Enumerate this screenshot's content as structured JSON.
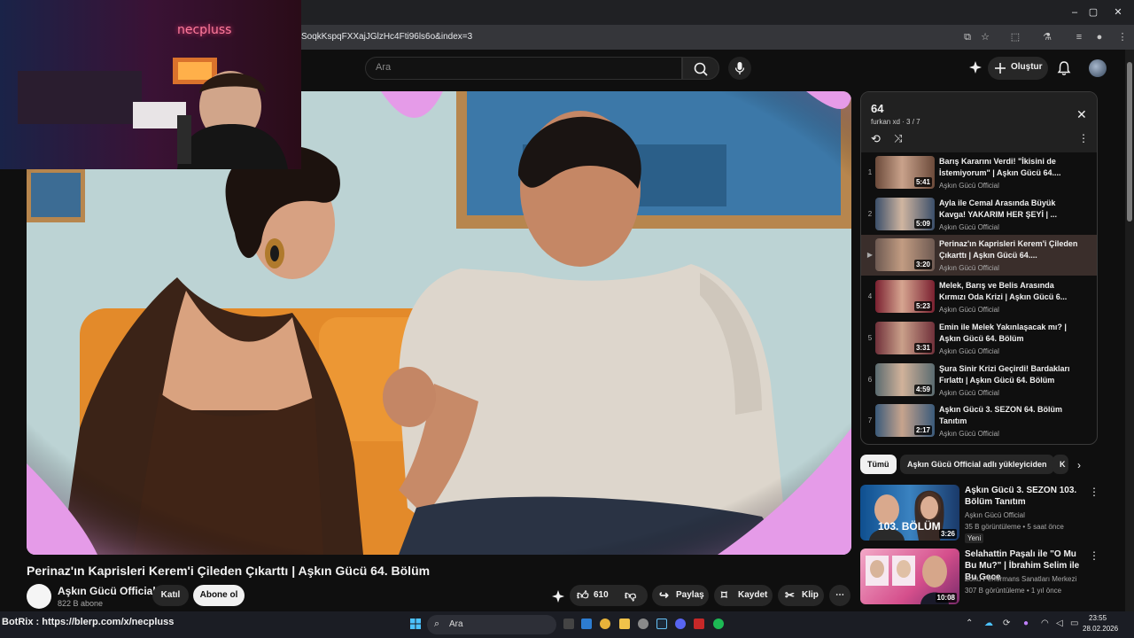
{
  "browser": {
    "url_fragment": "SoqkKspqFXXajJGlzHc4Fti96ls6o&index=3",
    "window_controls": [
      "–",
      "▢",
      "✕"
    ]
  },
  "header": {
    "search_placeholder": "Ara",
    "create_label": "Oluştur"
  },
  "stream_overlay": {
    "cam_logo": "necpluss",
    "botrix_text": "BotRix : https://blerp.com/x/necpluss"
  },
  "video": {
    "title": "Perinaz'ın Kaprisleri Kerem'i Çileden Çıkarttı | Aşkın Gücü 64. Bölüm",
    "channel_name": "Aşkın Gücü Official",
    "channel_subs": "822 B abone",
    "join_label": "Katıl",
    "subscribe_label": "Abone ol",
    "like_count": "610",
    "share_label": "Paylaş",
    "save_label": "Kaydet",
    "clip_label": "Klip"
  },
  "playlist": {
    "title": "64",
    "subtitle": "furkan xd · 3 / 7",
    "items": [
      {
        "index": "1",
        "title": "Barış Kararını Verdi! \"İkisini de İstemiyorum\" | Aşkın Gücü 64....",
        "channel": "Aşkın Gücü Official",
        "duration": "5:41",
        "active": false
      },
      {
        "index": "2",
        "title": "Ayla ile Cemal Arasında Büyük Kavga! YAKARIM HER ŞEYİ | ...",
        "channel": "Aşkın Gücü Official",
        "duration": "5:09",
        "active": false
      },
      {
        "index": "▶",
        "title": "Perinaz'ın Kaprisleri Kerem'i Çileden Çıkarttı | Aşkın Gücü 64....",
        "channel": "Aşkın Gücü Official",
        "duration": "3:20",
        "active": true
      },
      {
        "index": "4",
        "title": "Melek, Barış ve Belis Arasında Kırmızı Oda Krizi | Aşkın Gücü 6...",
        "channel": "Aşkın Gücü Official",
        "duration": "5:23",
        "active": false
      },
      {
        "index": "5",
        "title": "Emin ile Melek Yakınlaşacak mı? | Aşkın Gücü 64. Bölüm",
        "channel": "Aşkın Gücü Official",
        "duration": "3:31",
        "active": false
      },
      {
        "index": "6",
        "title": "Şura Sinir Krizi Geçirdi! Bardakları Fırlattı | Aşkın Gücü 64. Bölüm",
        "channel": "Aşkın Gücü Official",
        "duration": "4:59",
        "active": false
      },
      {
        "index": "7",
        "title": "Aşkın Gücü 3. SEZON 64. Bölüm Tanıtım",
        "channel": "Aşkın Gücü Official",
        "duration": "2:17",
        "active": false
      }
    ]
  },
  "chips": [
    "Tümü",
    "Aşkın Gücü Official adlı yükleyiciden",
    "K"
  ],
  "recommendations": [
    {
      "title": "Aşkın Gücü 3. SEZON 103. Bölüm Tanıtım",
      "channel": "Aşkın Gücü Official",
      "meta": "35 B görüntüleme • 5 saat önce",
      "badge": "Yeni",
      "duration": "3:26",
      "thumb_text": "103. BÖLÜM"
    },
    {
      "title": "Selahattin Paşalı ile \"O Mu Bu Mu?\" | İbrahim Selim ile Bu Gece",
      "channel": "Zorlu Performans Sanatları Merkezi",
      "meta": "307 B görüntüleme • 1 yıl önce",
      "badge": "",
      "duration": "10:08",
      "thumb_text": ""
    }
  ],
  "taskbar": {
    "search_label": "Ara",
    "time": "23:55",
    "date": "28.02.2026"
  },
  "colors": {
    "accent_pink": "#e59be8",
    "active_row": "#3a2e2b",
    "background": "#0f0f0f"
  }
}
